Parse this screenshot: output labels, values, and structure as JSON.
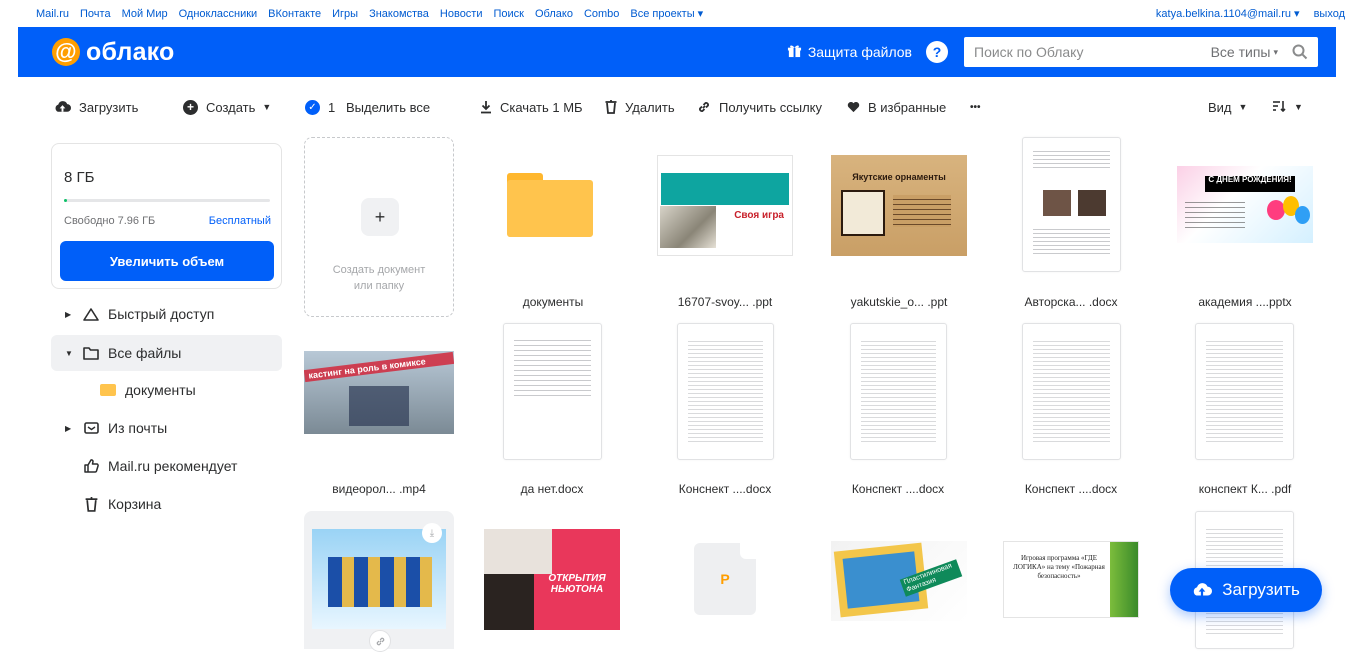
{
  "portal": {
    "links": [
      "Mail.ru",
      "Почта",
      "Мой Мир",
      "Одноклассники",
      "ВКонтакте",
      "Игры",
      "Знакомства",
      "Новости",
      "Поиск",
      "Облако",
      "Combo",
      "Все проекты ▾"
    ],
    "user": "katya.belkina.1104@mail.ru ▾",
    "exit": "выход"
  },
  "header": {
    "logo_text": "облако",
    "protect_label": "Защита файлов",
    "help_label": "?",
    "search_placeholder": "Поиск по Облаку",
    "types_label": "Все типы"
  },
  "toolbar": {
    "upload": "Загрузить",
    "create": "Создать",
    "selected_count": "1",
    "select_all": "Выделить все",
    "download": "Скачать 1 МБ",
    "delete": "Удалить",
    "get_link": "Получить ссылку",
    "favorite": "В избранные",
    "more": "•••",
    "view": "Вид"
  },
  "storage": {
    "total": "8 ГБ",
    "used_fraction": 0.005,
    "free": "Свободно 7.96 ГБ",
    "plan": "Бесплатный",
    "upgrade": "Увеличить объем"
  },
  "sidebar": {
    "items": [
      {
        "label": "Быстрый доступ"
      },
      {
        "label": "Все файлы"
      },
      {
        "label": "документы"
      },
      {
        "label": "Из почты"
      },
      {
        "label": "Mail.ru рекомендует"
      },
      {
        "label": "Корзина"
      }
    ]
  },
  "grid": {
    "create_label": "Создать документ или папку",
    "files": [
      {
        "name": "документы"
      },
      {
        "name": "16707-svoy... .ppt",
        "slide_title": "Своя игра"
      },
      {
        "name": "yakutskie_o... .ppt",
        "slide_title": "Якутские орнаменты"
      },
      {
        "name": "Авторска... .docx"
      },
      {
        "name": "академия ....pptx",
        "slide_title": "С ДНЕМ РОЖДЕНИЯ!"
      },
      {
        "name": "видеорол... .mp4",
        "slide_title": "кастинг на роль в комиксе"
      },
      {
        "name": "да нет.docx"
      },
      {
        "name": "Конснект ....docx"
      },
      {
        "name": "Конспект ....docx"
      },
      {
        "name": "Конспект ....docx"
      },
      {
        "name": "конспект К... .pdf"
      },
      {
        "slide_title": "ОТКРЫТИЯ НЬЮТОНА"
      },
      {
        "letter": "P"
      },
      {
        "slide_title": "Пластилиновая Фантазия"
      },
      {
        "slide_title": "Игровая программа «ГДЕ ЛОГИКА» на тему «Пожарная безопасность»"
      }
    ]
  },
  "fab": {
    "label": "Загрузить"
  },
  "colors": {
    "brand": "#005ff9",
    "folder": "#ffc44d",
    "accent_orange": "#ff9e00"
  }
}
